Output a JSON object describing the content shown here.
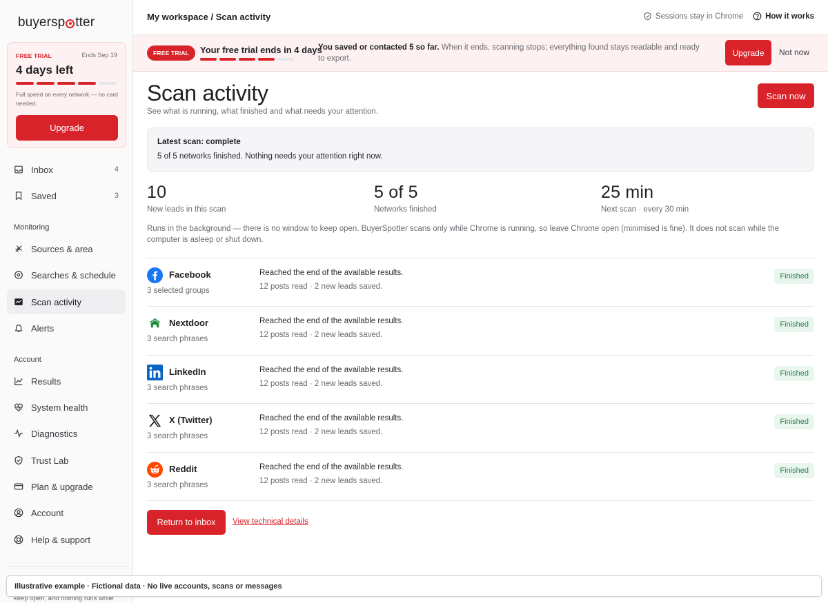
{
  "brand": {
    "name_before": "buyersp",
    "name_after": "tter",
    "accent": "#d9232a"
  },
  "trial_card": {
    "tag": "FREE TRIAL",
    "ends": "Ends Sep 19",
    "days_left": "4 days left",
    "progress_filled": 4,
    "progress_total": 5,
    "note": "Full speed on every network — no card needed.",
    "upgrade_label": "Upgrade"
  },
  "nav": {
    "main": [
      {
        "label": "Inbox",
        "count": "4",
        "icon": "inbox-icon"
      },
      {
        "label": "Saved",
        "count": "3",
        "icon": "bookmark-icon"
      }
    ],
    "monitoring_title": "Monitoring",
    "monitoring": [
      {
        "label": "Sources & area",
        "icon": "sources-icon"
      },
      {
        "label": "Searches & schedule",
        "icon": "target-icon"
      },
      {
        "label": "Scan activity",
        "icon": "activity-icon",
        "active": true
      },
      {
        "label": "Alerts",
        "icon": "bell-icon"
      }
    ],
    "account_title": "Account",
    "account": [
      {
        "label": "Results",
        "icon": "chart-icon"
      },
      {
        "label": "System health",
        "icon": "heart-icon"
      },
      {
        "label": "Diagnostics",
        "icon": "pulse-icon"
      },
      {
        "label": "Trust Lab",
        "icon": "shield-icon"
      },
      {
        "label": "Plan & upgrade",
        "icon": "card-icon"
      },
      {
        "label": "Account",
        "icon": "user-icon"
      },
      {
        "label": "Help & support",
        "icon": "lifebuoy-icon"
      }
    ],
    "cut_text": "keep open, and nothing runs while"
  },
  "topbar": {
    "crumb_parent": "My workspace",
    "crumb_sep": " / ",
    "crumb_current": "Scan activity",
    "sessions": "Sessions stay in Chrome",
    "how": "How it works"
  },
  "banner": {
    "pill": "FREE TRIAL",
    "title": "Your free trial ends in 4 days",
    "progress_filled": 4,
    "progress_total": 5,
    "msg_bold": "You saved or contacted 5 so far.",
    "msg_rest": " When it ends, scanning stops; everything found stays readable and ready to export.",
    "upgrade": "Upgrade",
    "dismiss": "Not now"
  },
  "page": {
    "title": "Scan activity",
    "subtitle": "See what is running, what finished and what needs your attention.",
    "scan_now": "Scan now"
  },
  "status": {
    "title": "Latest scan: complete",
    "detail": "5 of 5 networks finished. Nothing needs your attention right now."
  },
  "stats": [
    {
      "value": "10",
      "label": "New leads in this scan"
    },
    {
      "value": "5 of 5",
      "label": "Networks finished"
    },
    {
      "value": "25 min",
      "label": "Next scan · every 30 min"
    }
  ],
  "background_note": "Runs in the background — there is no window to keep open. BuyerSpotter scans only while Chrome is running, so leave Chrome open (minimised is fine). It does not scan while the computer is asleep or shut down.",
  "networks": [
    {
      "name": "Facebook",
      "sub": "3 selected groups",
      "msg1": "Reached the end of the available results.",
      "msg2": "12 posts read · 2 new leads saved.",
      "status": "Finished",
      "icon": "facebook-icon"
    },
    {
      "name": "Nextdoor",
      "sub": "3 search phrases",
      "msg1": "Reached the end of the available results.",
      "msg2": "12 posts read · 2 new leads saved.",
      "status": "Finished",
      "icon": "nextdoor-icon"
    },
    {
      "name": "LinkedIn",
      "sub": "3 search phrases",
      "msg1": "Reached the end of the available results.",
      "msg2": "12 posts read · 2 new leads saved.",
      "status": "Finished",
      "icon": "linkedin-icon"
    },
    {
      "name": "X (Twitter)",
      "sub": "3 search phrases",
      "msg1": "Reached the end of the available results.",
      "msg2": "12 posts read · 2 new leads saved.",
      "status": "Finished",
      "icon": "x-icon"
    },
    {
      "name": "Reddit",
      "sub": "3 search phrases",
      "msg1": "Reached the end of the available results.",
      "msg2": "12 posts read · 2 new leads saved.",
      "status": "Finished",
      "icon": "reddit-icon"
    }
  ],
  "actions": {
    "return": "Return to inbox",
    "technical": "View technical details"
  },
  "footer_note": "Illustrative example · Fictional data · No live accounts, scans or messages"
}
